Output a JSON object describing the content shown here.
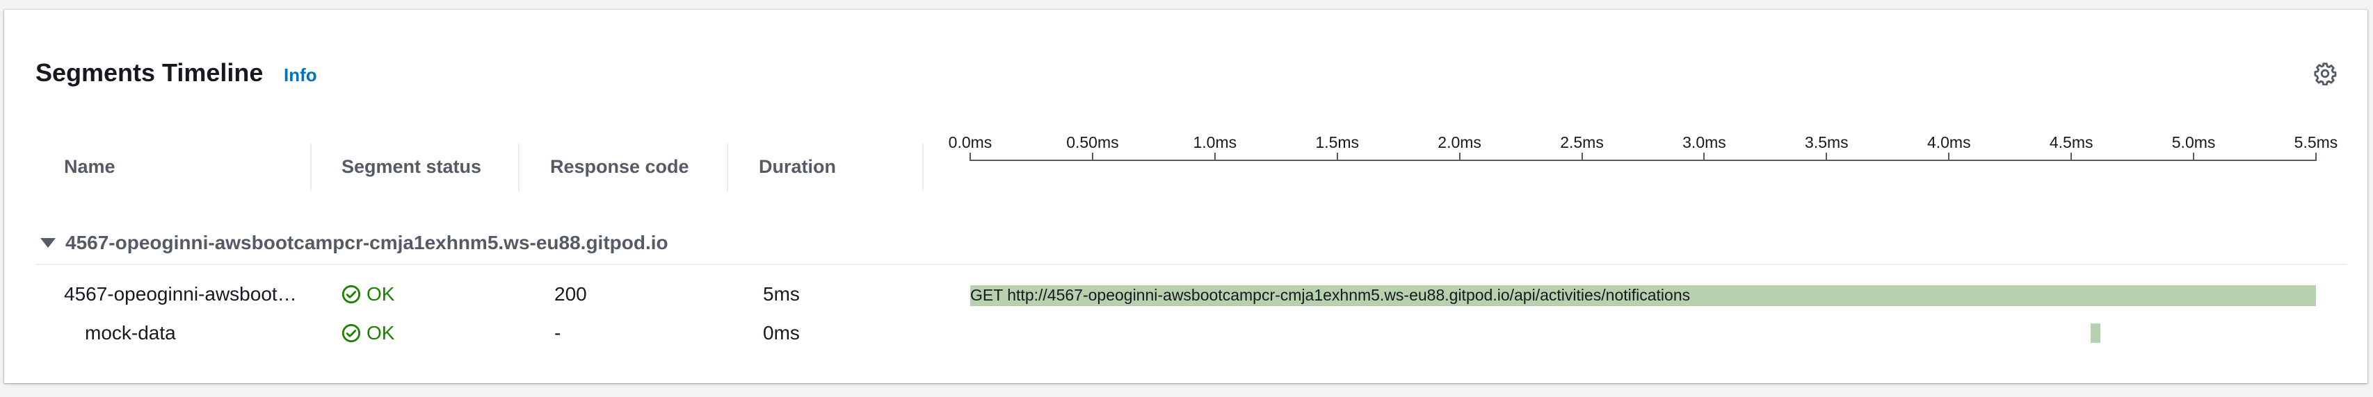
{
  "panel": {
    "title": "Segments Timeline",
    "info_label": "Info",
    "settings_icon": "gear-icon"
  },
  "columns": {
    "name": "Name",
    "segment_status": "Segment status",
    "response_code": "Response code",
    "duration": "Duration"
  },
  "timeline_axis": {
    "ticks": [
      "0.0ms",
      "0.50ms",
      "1.0ms",
      "1.5ms",
      "2.0ms",
      "2.5ms",
      "3.0ms",
      "3.5ms",
      "4.0ms",
      "4.5ms",
      "5.0ms",
      "5.5ms"
    ],
    "max_ms": 5.5
  },
  "group": {
    "label": "4567-opeoginni-awsbootcampcr-cmja1exhnm5.ws-eu88.gitpod.io",
    "expanded": true
  },
  "rows": [
    {
      "name": "4567-opeoginni-awsboot…",
      "status": "OK",
      "response_code": "200",
      "duration": "5ms",
      "bar_label": "GET http://4567-opeoginni-awsbootcampcr-cmja1exhnm5.ws-eu88.gitpod.io/api/activities/notifications",
      "start_ms": 0.0,
      "end_ms": 5.5
    },
    {
      "name": "mock-data",
      "status": "OK",
      "response_code": "-",
      "duration": "0ms",
      "bar_label": "",
      "start_ms": 4.58,
      "end_ms": 4.62
    }
  ],
  "colors": {
    "ok": "#1d8102",
    "bar": "#b7d1ae",
    "link": "#0073bb"
  }
}
